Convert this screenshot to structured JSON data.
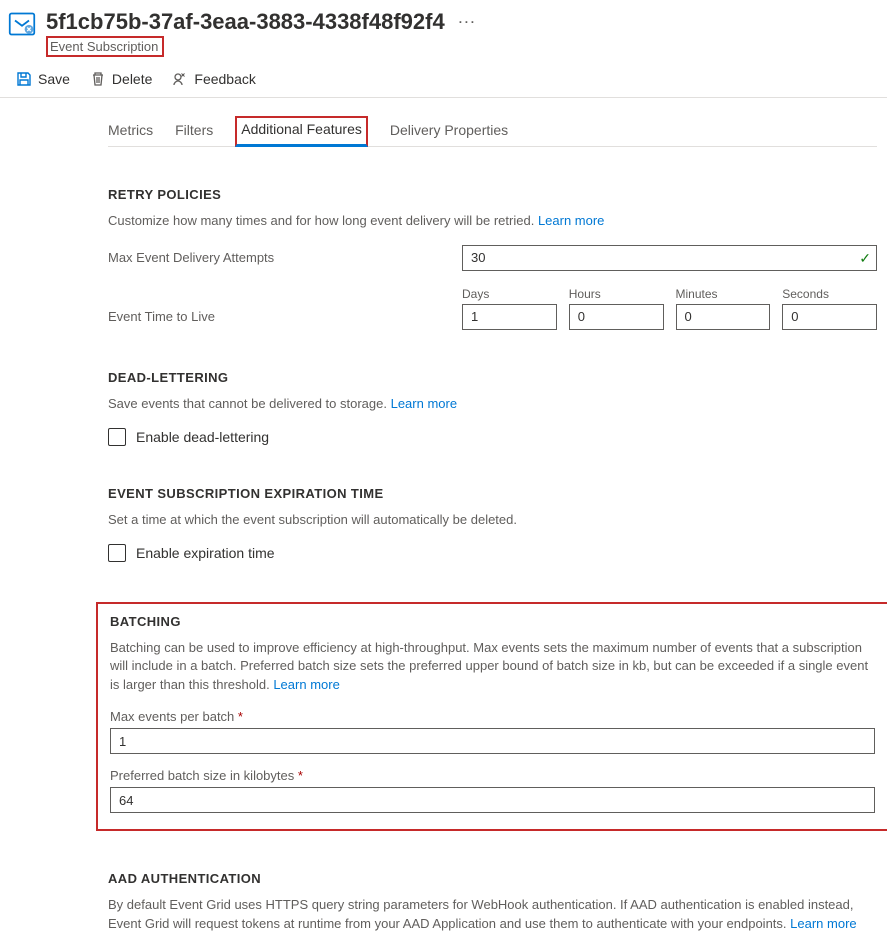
{
  "header": {
    "title": "5f1cb75b-37af-3eaa-3883-4338f48f92f4",
    "subtitle": "Event Subscription"
  },
  "toolbar": {
    "save": "Save",
    "delete": "Delete",
    "feedback": "Feedback"
  },
  "tabs": {
    "metrics": "Metrics",
    "filters": "Filters",
    "features": "Additional Features",
    "delivery": "Delivery Properties"
  },
  "retry": {
    "heading": "RETRY POLICIES",
    "desc": "Customize how many times and for how long event delivery will be retried.",
    "learn": "Learn more",
    "max_label": "Max Event Delivery Attempts",
    "max_value": "30",
    "ttl_label": "Event Time to Live",
    "ttl": {
      "days_label": "Days",
      "days_value": "1",
      "hours_label": "Hours",
      "hours_value": "0",
      "minutes_label": "Minutes",
      "minutes_value": "0",
      "seconds_label": "Seconds",
      "seconds_value": "0"
    }
  },
  "dead": {
    "heading": "DEAD-LETTERING",
    "desc": "Save events that cannot be delivered to storage.",
    "learn": "Learn more",
    "checkbox": "Enable dead-lettering"
  },
  "expiration": {
    "heading": "EVENT SUBSCRIPTION EXPIRATION TIME",
    "desc": "Set a time at which the event subscription will automatically be deleted.",
    "checkbox": "Enable expiration time"
  },
  "batching": {
    "heading": "BATCHING",
    "desc": "Batching can be used to improve efficiency at high-throughput. Max events sets the maximum number of events that a subscription will include in a batch. Preferred batch size sets the preferred upper bound of batch size in kb, but can be exceeded if a single event is larger than this threshold.",
    "learn": "Learn more",
    "max_label": "Max events per batch",
    "max_value": "1",
    "size_label": "Preferred batch size in kilobytes",
    "size_value": "64"
  },
  "aad": {
    "heading": "AAD AUTHENTICATION",
    "desc": "By default Event Grid uses HTTPS query string parameters for WebHook authentication. If AAD authentication is enabled instead, Event Grid will request tokens at runtime from your AAD Application and use them to authenticate with your endpoints.",
    "learn": "Learn more"
  }
}
